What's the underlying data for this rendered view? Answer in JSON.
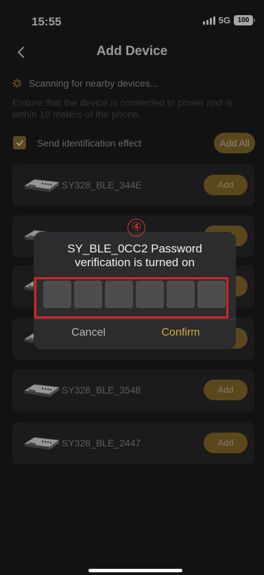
{
  "status_bar": {
    "time": "15:55",
    "network": "5G",
    "battery": "100"
  },
  "nav": {
    "title": "Add Device",
    "back_icon": "chevron-left-icon"
  },
  "scan": {
    "status": "Scanning for nearby devices...",
    "hint": "Ensure that the device is connected to power and is within 10 meters of the phone."
  },
  "identification": {
    "label": "Send identification effect",
    "checked": true,
    "add_all_label": "Add All"
  },
  "devices": [
    {
      "name": "SY328_BLE_344E",
      "add_label": "Add"
    },
    {
      "name": "",
      "add_label": "Add"
    },
    {
      "name": "",
      "add_label": "Add"
    },
    {
      "name": "",
      "add_label": "Add"
    },
    {
      "name": "SY328_BLE_3548",
      "add_label": "Add"
    },
    {
      "name": "SY328_BLE_2447",
      "add_label": "Add"
    }
  ],
  "dialog": {
    "title_line1": "SY_BLE_0CC2 Password",
    "title_line2": "verification is turned on",
    "pin_length": 6,
    "cancel_label": "Cancel",
    "confirm_label": "Confirm"
  },
  "annotation": {
    "step_marker": "④",
    "highlight_color": "#d7261e"
  },
  "colors": {
    "accent": "#8a6e2b",
    "confirm_text": "#d6a938",
    "background": "#1c1c1e",
    "card": "#2a2a2c"
  }
}
